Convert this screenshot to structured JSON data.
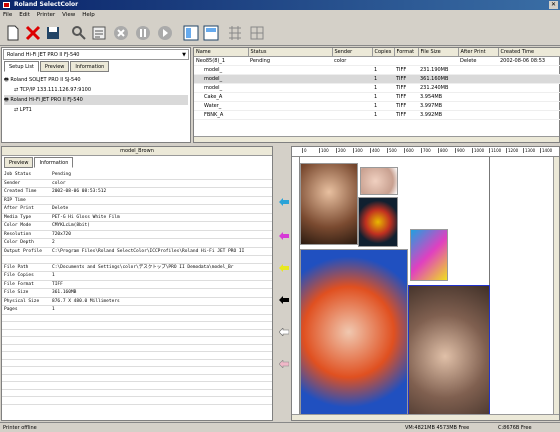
{
  "window": {
    "title": "Roland SelectColor"
  },
  "menu": [
    "File",
    "Edit",
    "Printer",
    "View",
    "Help"
  ],
  "toolbar": [
    "new",
    "delete",
    "save",
    "search",
    "properties",
    "stop",
    "pause",
    "play",
    "layout",
    "arrange",
    "grid",
    "grid-alt"
  ],
  "left_tabs": [
    "Setup List",
    "Preview",
    "Information"
  ],
  "printer_tree": [
    {
      "label": "Roland SOLJET PRO II SJ-540",
      "type": "printer"
    },
    {
      "label": "TCP/IP 133.111.126.97:9100",
      "type": "port"
    },
    {
      "label": "Roland Hi-Fi JET PRO II FJ-540",
      "type": "printer",
      "selected": true
    },
    {
      "label": "LPT1",
      "type": "port"
    }
  ],
  "combo": {
    "value": "Roland Hi-Fi JET PRO II FJ-540"
  },
  "job_columns": [
    "Name",
    "Status",
    "Sender",
    "Copies",
    "Format",
    "File Size",
    "After Print",
    "Created Time"
  ],
  "jobs": [
    {
      "name": "Neo85(8)_1",
      "status": "Pending",
      "sender": "color",
      "copies": "",
      "format": "",
      "size": "",
      "after": "Delete",
      "time": "2002-08-06 08:53"
    },
    {
      "name": "model_",
      "status": "",
      "sender": "",
      "copies": "1",
      "format": "TIFF",
      "size": "231.190MB",
      "after": "",
      "time": ""
    },
    {
      "name": "model_",
      "status": "",
      "sender": "",
      "copies": "1",
      "format": "TIFF",
      "size": "361.160MB",
      "after": "",
      "time": ""
    },
    {
      "name": "model_",
      "status": "",
      "sender": "",
      "copies": "1",
      "format": "TIFF",
      "size": "231.240MB",
      "after": "",
      "time": ""
    },
    {
      "name": "Cake_A",
      "status": "",
      "sender": "",
      "copies": "1",
      "format": "TIFF",
      "size": "3.954MB",
      "after": "",
      "time": ""
    },
    {
      "name": "Water_",
      "status": "",
      "sender": "",
      "copies": "1",
      "format": "TIFF",
      "size": "3.997MB",
      "after": "",
      "time": ""
    },
    {
      "name": "FBNK_A",
      "status": "",
      "sender": "",
      "copies": "1",
      "format": "TIFF",
      "size": "3.992MB",
      "after": "",
      "time": ""
    }
  ],
  "detail": {
    "title": "model_Brown",
    "tabs": [
      "Preview",
      "Information"
    ],
    "rows": [
      [
        "Job Status",
        "Pending"
      ],
      [
        "Sender",
        "color"
      ],
      [
        "Created Time",
        "2002-08-06 08:53:512"
      ],
      [
        "RIP Time",
        ""
      ],
      [
        "After Print",
        "Delete"
      ],
      [
        "Media Type",
        "PET-G  Hi Gloss White Film"
      ],
      [
        "Color Mode",
        "CMYKLcLm(8bit)"
      ],
      [
        "Resolution",
        "720x720"
      ],
      [
        "Color Depth",
        "2"
      ],
      [
        "Output Profile",
        "C:\\Program Files\\Roland SelectColor\\ICCProfiles\\Roland Hi-Fi JET PRO II"
      ],
      [
        "",
        ""
      ],
      [
        "File Path",
        "C:\\Documents and Settings\\color\\デスクトップ\\PRO II Demodata\\model_Br"
      ],
      [
        "File Copies",
        "1"
      ],
      [
        "File Format",
        "TIFF"
      ],
      [
        "File Size",
        "361.160MB"
      ],
      [
        "Physical Size",
        "876.7 X 480.0 Millimeters"
      ],
      [
        "Pages",
        "1"
      ]
    ]
  },
  "ruler_ticks": [
    "0",
    "100",
    "200",
    "300",
    "400",
    "500",
    "600",
    "700",
    "800",
    "900",
    "1000",
    "1100",
    "1200",
    "1300",
    "1400"
  ],
  "status": {
    "left": "Printer offline",
    "right": [
      "VM:4821MB 4573MB Free",
      "C:8676B Free"
    ]
  },
  "colors": {
    "arrows": [
      "#2aa3d8",
      "#d63ad6",
      "#e8e820",
      "#000000",
      "#ffffff",
      "#f0b8c8"
    ]
  }
}
